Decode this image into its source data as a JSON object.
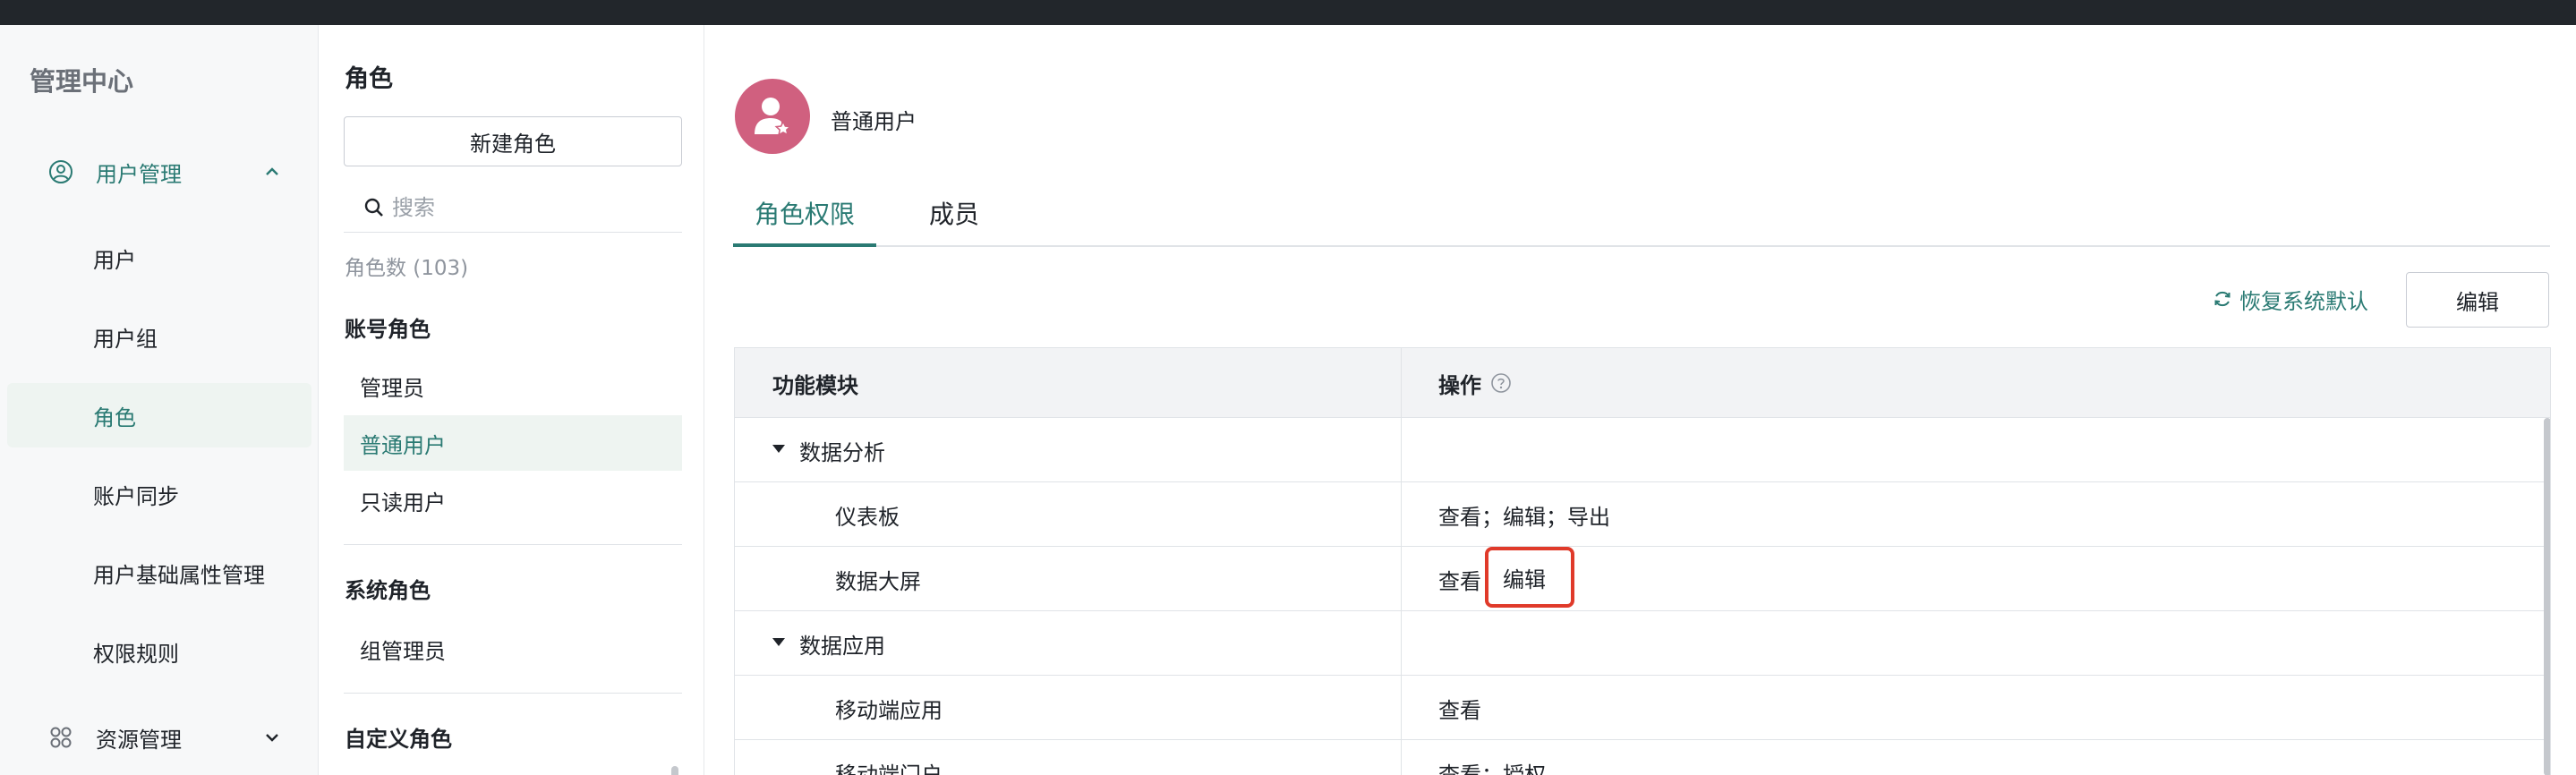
{
  "nav": {
    "title": "管理中心",
    "groups": [
      {
        "label": "用户管理",
        "icon": "user-circle-icon",
        "expanded": true
      },
      {
        "label": "资源管理",
        "icon": "grid-icon",
        "expanded": false
      }
    ],
    "items": [
      "用户",
      "用户组",
      "角色",
      "账户同步",
      "用户基础属性管理",
      "权限规则"
    ],
    "selected": "角色"
  },
  "roles": {
    "title": "角色",
    "new_button": "新建角色",
    "search_placeholder": "搜索",
    "count_label": "角色数 (103)",
    "sections": [
      {
        "title": "账号角色",
        "items": [
          "管理员",
          "普通用户",
          "只读用户"
        ]
      },
      {
        "title": "系统角色",
        "items": [
          "组管理员"
        ]
      },
      {
        "title": "自定义角色",
        "items": []
      }
    ],
    "selected": "普通用户"
  },
  "main": {
    "role_name": "普通用户",
    "tabs": [
      "角色权限",
      "成员"
    ],
    "active_tab": "角色权限",
    "restore_label": "恢复系统默认",
    "edit_label": "编辑",
    "table": {
      "headers": [
        "功能模块",
        "操作"
      ],
      "rows": [
        {
          "name": "数据分析",
          "op": "",
          "group": true
        },
        {
          "name": "仪表板",
          "op": "查看；编辑；导出",
          "group": false
        },
        {
          "name": "数据大屏",
          "op": "查看",
          "group": false
        },
        {
          "name": "数据应用",
          "op": "",
          "group": true
        },
        {
          "name": "移动端应用",
          "op": "查看",
          "group": false
        },
        {
          "name": "移动端门户",
          "op": "查看；授权",
          "group": false
        }
      ],
      "highlighted_op": "编辑"
    }
  },
  "colors": {
    "accent": "#2a7a73",
    "avatar": "#d0607f",
    "highlight": "#e03a2a",
    "topbar": "#22262b"
  }
}
